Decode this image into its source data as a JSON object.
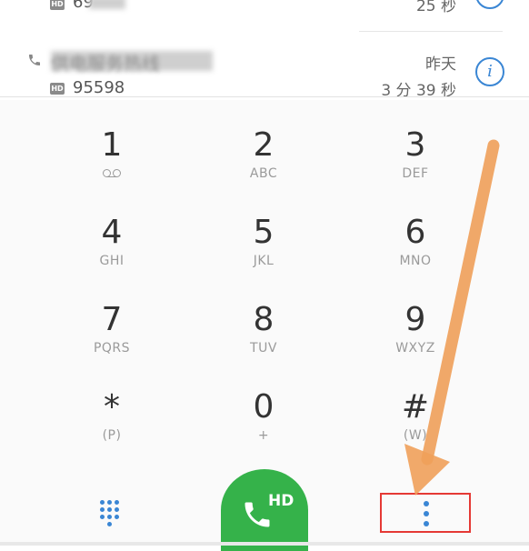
{
  "calls": [
    {
      "number": "69",
      "duration": "25 秒"
    },
    {
      "name": "供电服务热线",
      "number": "95598",
      "date": "昨天",
      "duration": "3 分 39 秒"
    }
  ],
  "hd_badge": "HD",
  "keys": [
    {
      "digit": "1",
      "letters": ""
    },
    {
      "digit": "2",
      "letters": "ABC"
    },
    {
      "digit": "3",
      "letters": "DEF"
    },
    {
      "digit": "4",
      "letters": "GHI"
    },
    {
      "digit": "5",
      "letters": "JKL"
    },
    {
      "digit": "6",
      "letters": "MNO"
    },
    {
      "digit": "7",
      "letters": "PQRS"
    },
    {
      "digit": "8",
      "letters": "TUV"
    },
    {
      "digit": "9",
      "letters": "WXYZ"
    },
    {
      "digit": "*",
      "letters": "(P)"
    },
    {
      "digit": "0",
      "letters": "+"
    },
    {
      "digit": "#",
      "letters": "(W)"
    }
  ],
  "call_button": {
    "label": "HD"
  },
  "colors": {
    "accent": "#3a86d4",
    "call": "#35b24a",
    "highlight": "#e53935",
    "arrow": "#f0a05a"
  },
  "icons": [
    "phone-icon",
    "info-icon",
    "voicemail-icon",
    "dialpad-grid-icon",
    "more-vert-icon"
  ]
}
